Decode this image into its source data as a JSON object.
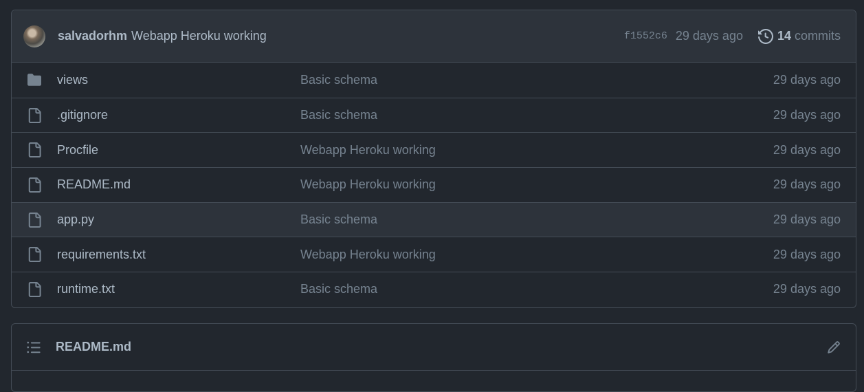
{
  "commit": {
    "author": "salvadorhm",
    "message": "Webapp Heroku working",
    "sha": "f1552c6",
    "age": "29 days ago",
    "commits_count": "14",
    "commits_label": "commits"
  },
  "files": [
    {
      "type": "folder",
      "name": "views",
      "message": "Basic schema",
      "age": "29 days ago"
    },
    {
      "type": "file",
      "name": ".gitignore",
      "message": "Basic schema",
      "age": "29 days ago"
    },
    {
      "type": "file",
      "name": "Procfile",
      "message": "Webapp Heroku working",
      "age": "29 days ago"
    },
    {
      "type": "file",
      "name": "README.md",
      "message": "Webapp Heroku working",
      "age": "29 days ago"
    },
    {
      "type": "file",
      "name": "app.py",
      "message": "Basic schema",
      "age": "29 days ago"
    },
    {
      "type": "file",
      "name": "requirements.txt",
      "message": "Webapp Heroku working",
      "age": "29 days ago"
    },
    {
      "type": "file",
      "name": "runtime.txt",
      "message": "Basic schema",
      "age": "29 days ago"
    }
  ],
  "readme": {
    "title": "README.md"
  },
  "icons": {
    "folder": "folder-icon",
    "file": "file-icon",
    "history": "history-icon",
    "list": "list-icon",
    "edit": "pencil-icon"
  },
  "colors": {
    "background": "#22272e",
    "header_bg": "#2d333b",
    "border": "#444c56",
    "text": "#adbac7",
    "muted": "#768390"
  }
}
